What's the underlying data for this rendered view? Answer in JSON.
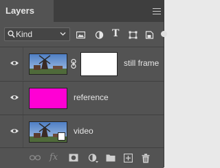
{
  "panel": {
    "tab_title": "Layers",
    "menu_icon": "panel-menu-icon"
  },
  "filter": {
    "search_icon": "search-icon",
    "kind_label": "Kind",
    "chevron_icon": "chevron-down-icon",
    "filter_icons": [
      "image-filter-icon",
      "adjustment-filter-icon",
      "type-filter-icon",
      "shape-filter-icon",
      "smart-object-filter-icon"
    ],
    "type_glyph": "T"
  },
  "layers": [
    {
      "name": "still frame",
      "visible": true,
      "thumbnail": "landscape-windmill",
      "has_mask": true
    },
    {
      "name": "reference",
      "visible": true,
      "thumbnail": "solid-color",
      "color": "#ff00d4"
    },
    {
      "name": "video",
      "visible": true,
      "thumbnail": "landscape-windmill",
      "is_video": true
    }
  ],
  "bottom_bar": {
    "fx_label": "fx",
    "icons": [
      "link-layers-icon",
      "fx-icon",
      "add-mask-icon",
      "adjustment-layer-icon",
      "new-group-icon",
      "new-layer-icon",
      "delete-icon"
    ]
  },
  "colors": {
    "panel_bg": "#535353",
    "tab_bar_bg": "#3e3e3e",
    "text": "#e6e6e6",
    "magenta": "#ff00d4"
  }
}
